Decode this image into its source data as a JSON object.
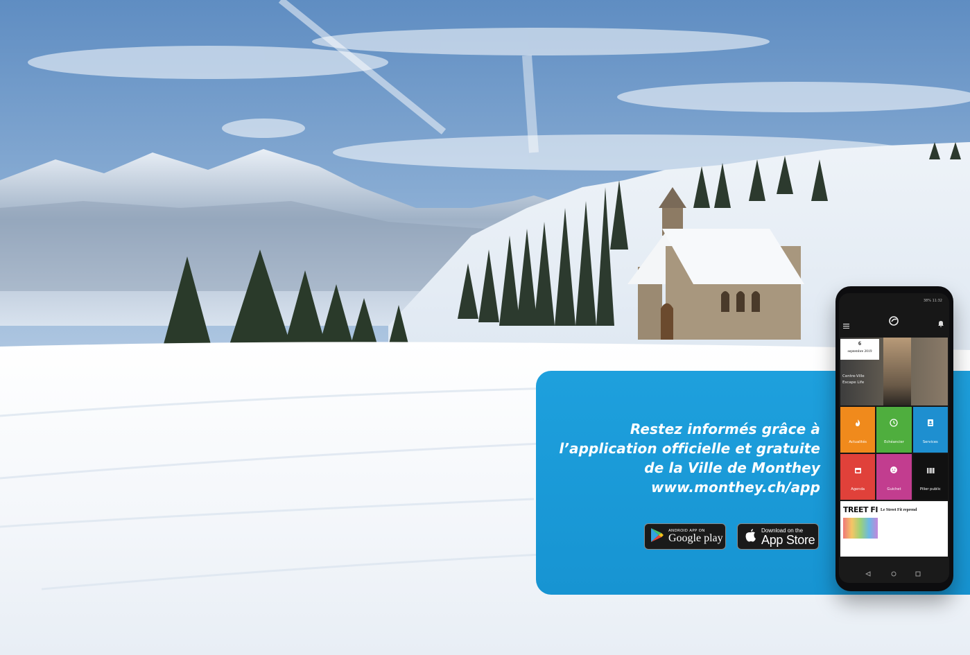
{
  "promo": {
    "line1": "Restez informés grâce à",
    "line2": "l’application officielle et gratuite",
    "line3": "de la Ville de Monthey",
    "line4": "www.monthey.ch/app"
  },
  "badges": {
    "google_small": "ANDROID APP ON",
    "google_big": "Google play",
    "apple_small": "Download on the",
    "apple_big": "App Store"
  },
  "phone": {
    "status_time": "11:32",
    "status_battery": "38%",
    "date_day": "6",
    "date_month": "septembre 2019",
    "hero_caption_1": "Centre-Ville",
    "hero_caption_2": "Escape Life",
    "tiles": [
      {
        "label": "Actualités",
        "color": "#f08a1c",
        "icon": "flame-icon"
      },
      {
        "label": "Echéancier",
        "color": "#4fae3e",
        "icon": "clock-icon"
      },
      {
        "label": "Services",
        "color": "#1e8fd0",
        "icon": "badge-icon"
      },
      {
        "label": "Agenda",
        "color": "#e0413a",
        "icon": "calendar-icon"
      },
      {
        "label": "Guichet",
        "color": "#c23d8f",
        "icon": "face-icon"
      },
      {
        "label": "Pilier public",
        "color": "#111111",
        "icon": "barcode-icon"
      }
    ],
    "news_brand": "TREET FI",
    "news_title": "Le Street Fit reprend"
  },
  "colors": {
    "panel_blue": "#1a9ad8",
    "sky": "#6f9ccc",
    "snow": "#f6f9fc"
  }
}
